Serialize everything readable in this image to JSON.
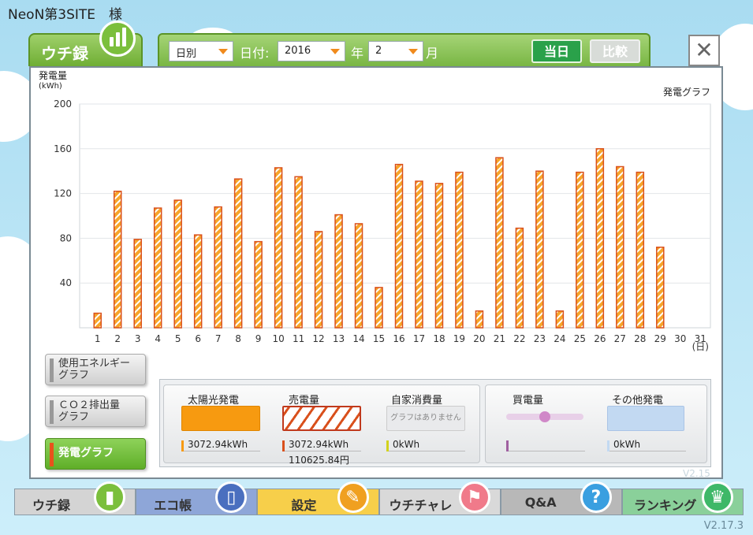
{
  "site_title": "NeoN第3SITE　様",
  "version": "V2.17.3",
  "version_faint": "V2.15",
  "header": {
    "tab_label": "ウチ録",
    "period_select": "日別",
    "date_label": "日付:",
    "year_select": "2016",
    "year_label": "年",
    "month_select": "2",
    "month_label": "月",
    "today_button": "当日",
    "compare_button": "比較",
    "close_icon": "✕"
  },
  "chart_title_y": "発電量",
  "chart_unit_y": "(kWh)",
  "graph_name": "発電グラフ",
  "x_unit_label": "(日)",
  "side_buttons": [
    {
      "line1": "使用エネルギー",
      "line2": "グラフ"
    },
    {
      "line1": "ＣＯ２排出量",
      "line2": "グラフ"
    },
    {
      "line1": "発電グラフ",
      "line2": ""
    }
  ],
  "summary": {
    "solar_label": "太陽光発電",
    "solar_value": "3072.94kWh",
    "sold_label": "売電量",
    "sold_value": "3072.94kWh",
    "sold_yen": "110625.84円",
    "self_label": "自家消費量",
    "self_nograph": "グラフはありません",
    "self_value": "0kWh",
    "bought_label": "買電量",
    "other_label": "その他発電",
    "other_value": "0kWh"
  },
  "nav": [
    {
      "label": "ウチ録",
      "color": "#d4d4d4",
      "icon_color": "#7bbf3c",
      "icon": "bars-icon"
    },
    {
      "label": "エコ帳",
      "color": "#8ea6d8",
      "icon_color": "#4a6fbf",
      "icon": "notebook-icon"
    },
    {
      "label": "設定",
      "color": "#f7cf4a",
      "icon_color": "#f0a020",
      "icon": "wrench-icon"
    },
    {
      "label": "ウチチャレ",
      "color": "#d9d9d9",
      "icon_color": "#f07a8a",
      "icon": "flag-icon"
    },
    {
      "label": "Q&A",
      "color": "#b8b8b8",
      "icon_color": "#3a9fe0",
      "icon": "question-icon"
    },
    {
      "label": "ランキング",
      "color": "#8ad09a",
      "icon_color": "#3eb868",
      "icon": "crown-icon"
    }
  ],
  "colors": {
    "bar_fill": "#f7a52a",
    "bar_stroke": "#d9501c",
    "toolbar_green": "#79b644"
  },
  "chart_data": {
    "type": "bar",
    "title": "発電グラフ",
    "ylabel": "発電量 (kWh)",
    "xlabel": "(日)",
    "ylim": [
      0,
      200
    ],
    "yticks": [
      40,
      80,
      120,
      160,
      200
    ],
    "categories": [
      "1",
      "2",
      "3",
      "4",
      "5",
      "6",
      "7",
      "8",
      "9",
      "10",
      "11",
      "12",
      "13",
      "14",
      "15",
      "16",
      "17",
      "18",
      "19",
      "20",
      "21",
      "22",
      "23",
      "24",
      "25",
      "26",
      "27",
      "28",
      "29",
      "30",
      "31"
    ],
    "values": [
      13,
      122,
      79,
      107,
      114,
      83,
      108,
      133,
      77,
      143,
      135,
      86,
      101,
      93,
      36,
      146,
      131,
      129,
      139,
      15,
      152,
      89,
      140,
      15,
      139,
      160,
      144,
      139,
      72,
      null,
      null
    ]
  }
}
